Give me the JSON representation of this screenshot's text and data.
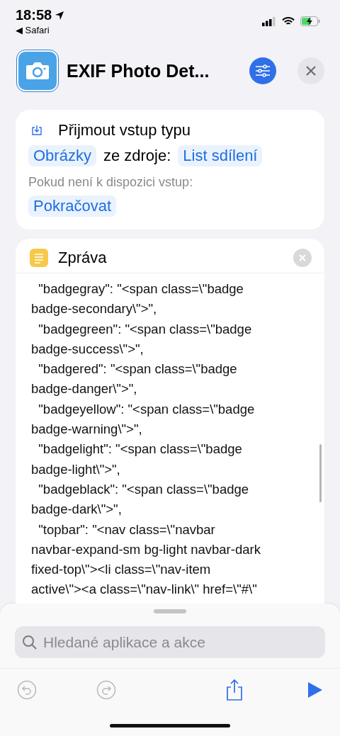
{
  "status_bar": {
    "time": "18:58",
    "back_app": "◀ Safari"
  },
  "header": {
    "title": "EXIF Photo Det..."
  },
  "input_card": {
    "title": "Přijmout vstup typu",
    "type_token": "Obrázky",
    "connector": "ze zdroje:",
    "source_token": "List sdílení",
    "fallback_label": "Pokud není k dispozici vstup:",
    "fallback_token": "Pokračovat"
  },
  "message_card": {
    "title": "Zpráva",
    "lines": [
      "  \"badgegray\": \"<span class=\\\"badge",
      "badge-secondary\\\">\",",
      "  \"badgegreen\": \"<span class=\\\"badge",
      "badge-success\\\">\",",
      "  \"badgered\": \"<span class=\\\"badge",
      "badge-danger\\\">\",",
      "  \"badgeyellow\": \"<span class=\\\"badge",
      "badge-warning\\\">\",",
      "  \"badgelight\": \"<span class=\\\"badge",
      "badge-light\\\">\",",
      "  \"badgeblack\": \"<span class=\\\"badge",
      "badge-dark\\\">\",",
      "  \"topbar\": \"<nav class=\\\"navbar",
      "navbar-expand-sm bg-light navbar-dark",
      "fixed-top\\\"><li class=\\\"nav-item",
      "active\\\"><a class=\\\"nav-link\\\" href=\\\"#\\\""
    ]
  },
  "bottom_sheet": {
    "search": {
      "placeholder": "Hledané aplikace a akce"
    },
    "toolbar": [
      {
        "kind": "undo",
        "disabled": true
      },
      {
        "kind": "redo",
        "disabled": true
      },
      {
        "kind": "share",
        "disabled": false
      },
      {
        "kind": "run",
        "disabled": false
      }
    ]
  }
}
